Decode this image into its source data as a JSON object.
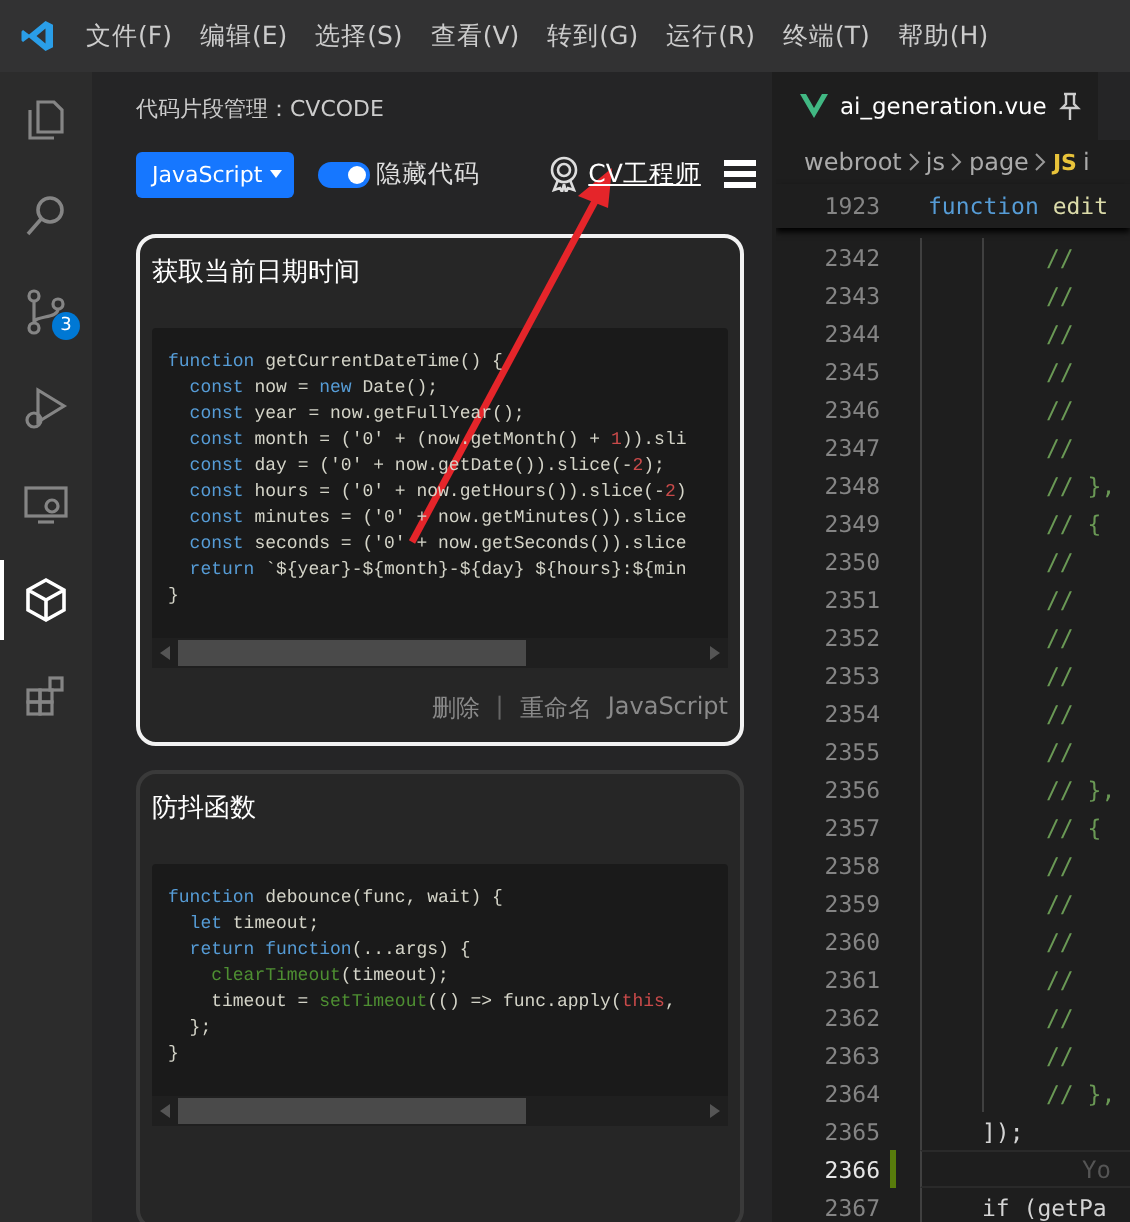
{
  "menu": [
    "文件(F)",
    "编辑(E)",
    "选择(S)",
    "查看(V)",
    "转到(G)",
    "运行(R)",
    "终端(T)",
    "帮助(H)"
  ],
  "activity_bar": [
    {
      "kind": "files",
      "selected": false
    },
    {
      "kind": "search",
      "selected": false
    },
    {
      "kind": "source-control",
      "selected": false,
      "badge": "3"
    },
    {
      "kind": "run-debug",
      "selected": false
    },
    {
      "kind": "remote",
      "selected": false
    },
    {
      "kind": "cube",
      "selected": true
    },
    {
      "kind": "extensions",
      "selected": false
    }
  ],
  "sidebar": {
    "title": "代码片段管理：CVCODE",
    "language_button": "JavaScript",
    "toggle": {
      "label": "隐藏代码",
      "on": true
    },
    "user_link": "CV工程师",
    "snippets": [
      {
        "title": "获取当前日期时间",
        "selected": true,
        "actions": [
          "删除",
          "重命名"
        ],
        "separator": "|",
        "language": "JavaScript",
        "code": [
          [
            {
              "t": "function ",
              "kind": "kw"
            },
            {
              "t": "getCurrentDateTime() {",
              "kind": "id"
            }
          ],
          [
            {
              "t": "  const ",
              "kind": "kw"
            },
            {
              "t": "now = ",
              "kind": "id"
            },
            {
              "t": "new ",
              "kind": "kw"
            },
            {
              "t": "Date();",
              "kind": "id"
            }
          ],
          [
            {
              "t": "  const ",
              "kind": "kw"
            },
            {
              "t": "year = now.getFullYear();",
              "kind": "id"
            }
          ],
          [
            {
              "t": "  const ",
              "kind": "kw"
            },
            {
              "t": "month = ('0' + (now.getMonth() + ",
              "kind": "id"
            },
            {
              "t": "1",
              "kind": "num"
            },
            {
              "t": ")).sli",
              "kind": "id"
            }
          ],
          [
            {
              "t": "  const ",
              "kind": "kw"
            },
            {
              "t": "day = ('0' + now.getDate()).slice(-",
              "kind": "id"
            },
            {
              "t": "2",
              "kind": "num"
            },
            {
              "t": ");",
              "kind": "id"
            }
          ],
          [
            {
              "t": "  const ",
              "kind": "kw"
            },
            {
              "t": "hours = ('0' + now.getHours()).slice(-",
              "kind": "id"
            },
            {
              "t": "2",
              "kind": "num"
            },
            {
              "t": ")",
              "kind": "id"
            }
          ],
          [
            {
              "t": "  const ",
              "kind": "kw"
            },
            {
              "t": "minutes = ('0' + now.getMinutes()).slice",
              "kind": "id"
            }
          ],
          [
            {
              "t": "  const ",
              "kind": "kw"
            },
            {
              "t": "seconds = ('0' + now.getSeconds()).slice",
              "kind": "id"
            }
          ],
          [
            {
              "t": "  return ",
              "kind": "kw"
            },
            {
              "t": "`${year}-${month}-${day} ${hours}:${min",
              "kind": "id"
            }
          ],
          [
            {
              "t": "}",
              "kind": "id"
            }
          ]
        ]
      },
      {
        "title": "防抖函数",
        "selected": false,
        "code": [
          [
            {
              "t": "function ",
              "kind": "kw"
            },
            {
              "t": "debounce(func, wait) {",
              "kind": "id"
            }
          ],
          [
            {
              "t": "  let ",
              "kind": "kw"
            },
            {
              "t": "timeout;",
              "kind": "id"
            }
          ],
          [
            {
              "t": "  return ",
              "kind": "kw"
            },
            {
              "t": "function",
              "kind": "kw"
            },
            {
              "t": "(...args) {",
              "kind": "id"
            }
          ],
          [
            {
              "t": "    clearTimeout",
              "kind": "builtin"
            },
            {
              "t": "(timeout);",
              "kind": "id"
            }
          ],
          [
            {
              "t": "    timeout = ",
              "kind": "id"
            },
            {
              "t": "setTimeout",
              "kind": "builtin"
            },
            {
              "t": "(() => func.apply(",
              "kind": "id"
            },
            {
              "t": "this",
              "kind": "num"
            },
            {
              "t": ",",
              "kind": "id"
            }
          ],
          [
            {
              "t": "  };",
              "kind": "id"
            }
          ],
          [
            {
              "t": "}",
              "kind": "id"
            }
          ]
        ]
      }
    ]
  },
  "editor": {
    "tab": {
      "label": "ai_generation.vue",
      "pinned": true
    },
    "breadcrumbs": [
      {
        "label": "webroot"
      },
      {
        "label": "js"
      },
      {
        "label": "page"
      },
      {
        "icon": "JS",
        "label": "i"
      }
    ],
    "sticky_line": {
      "num": "1923",
      "code": [
        {
          "t": "function ",
          "kind": "kw"
        },
        {
          "t": "edit",
          "kind": "fn"
        }
      ]
    },
    "lines": [
      {
        "num": "2342",
        "text": "//",
        "kind": "comment"
      },
      {
        "num": "2343",
        "text": "//",
        "kind": "comment"
      },
      {
        "num": "2344",
        "text": "//",
        "kind": "comment"
      },
      {
        "num": "2345",
        "text": "//",
        "kind": "comment"
      },
      {
        "num": "2346",
        "text": "//",
        "kind": "comment"
      },
      {
        "num": "2347",
        "text": "//",
        "kind": "comment"
      },
      {
        "num": "2348",
        "text": "// },",
        "kind": "comment"
      },
      {
        "num": "2349",
        "text": "// {",
        "kind": "comment"
      },
      {
        "num": "2350",
        "text": "//",
        "kind": "comment"
      },
      {
        "num": "2351",
        "text": "//",
        "kind": "comment"
      },
      {
        "num": "2352",
        "text": "//",
        "kind": "comment"
      },
      {
        "num": "2353",
        "text": "//",
        "kind": "comment"
      },
      {
        "num": "2354",
        "text": "//",
        "kind": "comment"
      },
      {
        "num": "2355",
        "text": "//",
        "kind": "comment"
      },
      {
        "num": "2356",
        "text": "// },",
        "kind": "comment"
      },
      {
        "num": "2357",
        "text": "// {",
        "kind": "comment"
      },
      {
        "num": "2358",
        "text": "//",
        "kind": "comment"
      },
      {
        "num": "2359",
        "text": "//",
        "kind": "comment"
      },
      {
        "num": "2360",
        "text": "//",
        "kind": "comment"
      },
      {
        "num": "2361",
        "text": "//",
        "kind": "comment"
      },
      {
        "num": "2362",
        "text": "//",
        "kind": "comment"
      },
      {
        "num": "2363",
        "text": "//",
        "kind": "comment"
      },
      {
        "num": "2364",
        "text": "// },",
        "kind": "comment"
      },
      {
        "num": "2365",
        "text": "]);",
        "kind": "code"
      },
      {
        "num": "2366",
        "kind": "code",
        "current": true,
        "modified": true,
        "hint": "Yo"
      },
      {
        "num": "2367",
        "text": "if (getPa",
        "kind": "code"
      }
    ]
  },
  "overlay": {
    "kind": "arrow"
  }
}
